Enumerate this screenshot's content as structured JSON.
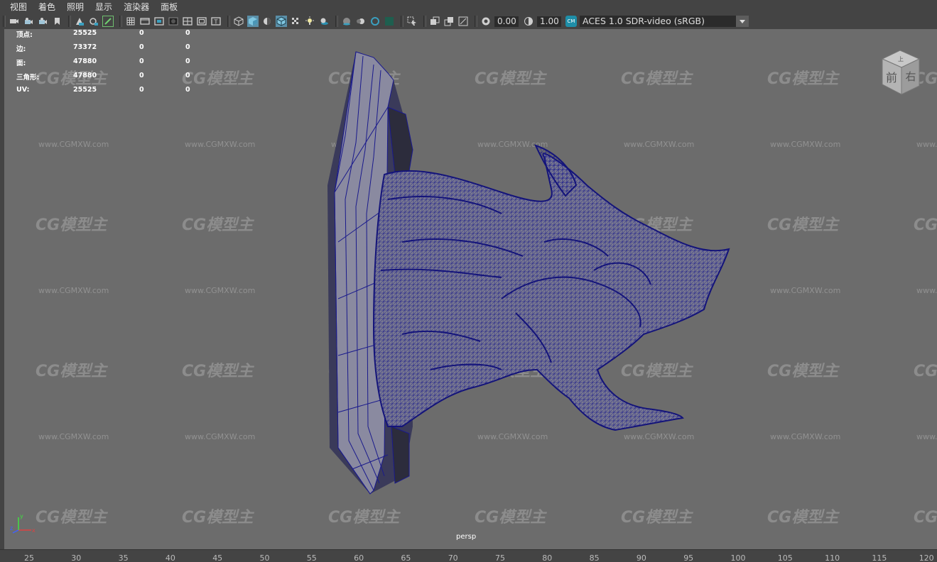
{
  "menu": [
    "视图",
    "着色",
    "照明",
    "显示",
    "渲染器",
    "面板"
  ],
  "toolbar": {
    "exposure_value": "0.00",
    "gamma_value": "1.00",
    "color_space": "ACES 1.0 SDR-video (sRGB)",
    "colorspace_badge": "CM"
  },
  "hud": {
    "rows": [
      {
        "label": "顶点:",
        "v1": "25525",
        "v2": "0",
        "v3": "0"
      },
      {
        "label": "边:",
        "v1": "73372",
        "v2": "0",
        "v3": "0"
      },
      {
        "label": "面:",
        "v1": "47880",
        "v2": "0",
        "v3": "0"
      },
      {
        "label": "三角形:",
        "v1": "47880",
        "v2": "0",
        "v3": "0"
      },
      {
        "label": "UV:",
        "v1": "25525",
        "v2": "0",
        "v3": "0"
      }
    ]
  },
  "viewcube": {
    "top": "上",
    "front": "前",
    "right": "右"
  },
  "watermark": {
    "logo": "CG模型主",
    "url": "www.CGMXW.com"
  },
  "camera": "persp",
  "axis": {
    "x": "x",
    "y": "y",
    "z": "z"
  },
  "ruler": [
    "25",
    "30",
    "35",
    "40",
    "45",
    "50",
    "55",
    "60",
    "65",
    "70",
    "75",
    "80",
    "85",
    "90",
    "95",
    "100",
    "105",
    "110",
    "115",
    "120"
  ],
  "colors": {
    "wireframe": "#1a1a8c",
    "viewport_bg": "#6c6c6c",
    "accent": "#1e8ea8"
  }
}
